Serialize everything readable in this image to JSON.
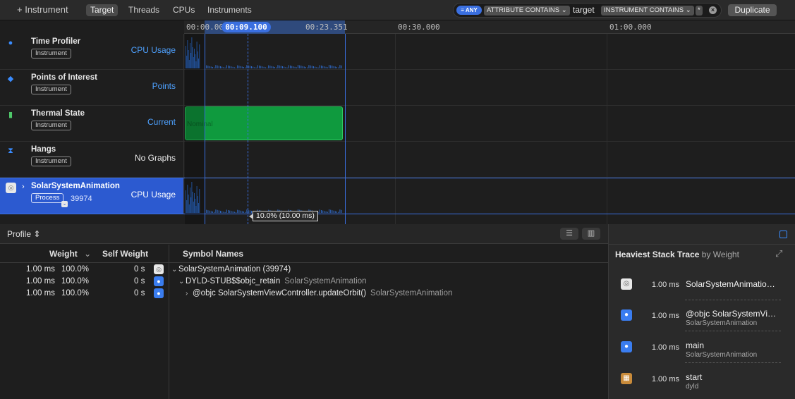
{
  "toolbar": {
    "add_instrument": "+ Instrument",
    "segments": [
      "Target",
      "Threads",
      "CPUs",
      "Instruments"
    ],
    "active_segment": "Target",
    "filter": {
      "any": "ANY",
      "attr_token": "ATTRIBUTE CONTAINS ⌄",
      "attr_value": "target",
      "inst_token": "INSTRUMENT CONTAINS ⌄",
      "inst_value": "*"
    },
    "duplicate": "Duplicate"
  },
  "timeline": {
    "ruler_labels": [
      "00:00.000",
      "00:23.351",
      "00:30.000",
      "01:00.000"
    ],
    "playhead": "00:09.100",
    "cpu_tooltip": "10.0% (10.00 ms)"
  },
  "tracks": [
    {
      "name": "Time Profiler",
      "badge": "Instrument",
      "measure": "CPU Usage",
      "icon": "clock-icon"
    },
    {
      "name": "Points of Interest",
      "badge": "Instrument",
      "measure": "Points",
      "icon": "pin-icon"
    },
    {
      "name": "Thermal State",
      "badge": "Instrument",
      "measure": "Current",
      "icon": "thermometer-icon",
      "bar_label": "Nominal"
    },
    {
      "name": "Hangs",
      "badge": "Instrument",
      "measure": "No Graphs",
      "icon": "hourglass-icon"
    },
    {
      "name": "SolarSystemAnimation",
      "badge": "Process",
      "pid": "39974",
      "measure": "CPU Usage",
      "icon": "app-icon"
    }
  ],
  "detail": {
    "mode": "Profile ⇕",
    "columns": {
      "weight": "Weight",
      "self_weight": "Self Weight",
      "symbol": "Symbol Names"
    },
    "rows": [
      {
        "weight": "1.00 ms",
        "pct": "100.0%",
        "self": "0 s",
        "icon": "app",
        "symbol": "SolarSystemAnimation (39974)",
        "lib": "",
        "disc": "⌄",
        "indent": 0
      },
      {
        "weight": "1.00 ms",
        "pct": "100.0%",
        "self": "0 s",
        "icon": "user",
        "symbol": "DYLD-STUB$$objc_retain",
        "lib": "SolarSystemAnimation",
        "disc": "⌄",
        "indent": 1
      },
      {
        "weight": "1.00 ms",
        "pct": "100.0%",
        "self": "0 s",
        "icon": "user",
        "symbol": "@objc SolarSystemViewController.updateOrbit()",
        "lib": "SolarSystemAnimation",
        "disc": "›",
        "indent": 2
      }
    ]
  },
  "inspector": {
    "title": "Heaviest Stack Trace",
    "subtitle": "by Weight",
    "frames": [
      {
        "time": "1.00 ms",
        "name": "SolarSystemAnimatio…",
        "lib": "",
        "icon": "app"
      },
      {
        "time": "1.00 ms",
        "name": "@objc SolarSystemVi…",
        "lib": "SolarSystemAnimation",
        "icon": "user"
      },
      {
        "time": "1.00 ms",
        "name": "main",
        "lib": "SolarSystemAnimation",
        "icon": "user"
      },
      {
        "time": "1.00 ms",
        "name": "start",
        "lib": "dyld",
        "icon": "lib"
      }
    ]
  },
  "colors": {
    "accent": "#3a6fe0",
    "thermal": "#0f9a3e",
    "cpu": "#2d68c4"
  }
}
